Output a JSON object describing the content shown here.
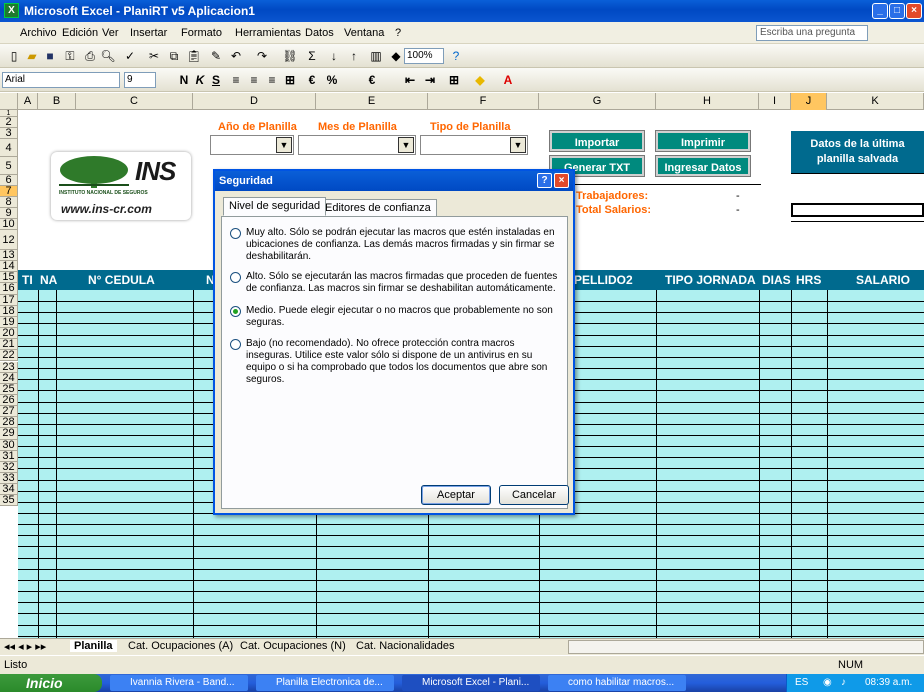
{
  "window": {
    "title": "Microsoft Excel - PlaniRT v5 Aplicacion1",
    "app_icon": "excel-icon"
  },
  "menu": {
    "items": [
      "Archivo",
      "Edición",
      "Ver",
      "Insertar",
      "Formato",
      "Herramientas",
      "Datos",
      "Ventana",
      "?"
    ],
    "ask_placeholder": "Escriba una pregunta"
  },
  "toolbar": {
    "zoom": "100%"
  },
  "format_bar": {
    "font": "Arial",
    "size": "9"
  },
  "columns": [
    "A",
    "B",
    "C",
    "D",
    "E",
    "F",
    "G",
    "H",
    "I",
    "J",
    "K"
  ],
  "selected_column": "J",
  "rows": [
    "1",
    "2",
    "3",
    "4",
    "5",
    "6",
    "7",
    "8",
    "9",
    "10",
    "12",
    "13",
    "14",
    "15",
    "16",
    "17",
    "18",
    "19",
    "20",
    "21",
    "22",
    "23",
    "24",
    "25",
    "26",
    "27",
    "28",
    "29",
    "30",
    "31",
    "32",
    "33",
    "34",
    "35"
  ],
  "selected_row": "7",
  "sheet": {
    "logo_text": "INS",
    "logo_sub": "INSTITUTO NACIONAL DE SEGUROS",
    "website": "www.ins-cr.com",
    "label_year": "Año de Planilla",
    "label_month": "Mes de Planilla",
    "label_type": "Tipo de Planilla",
    "btn_import": "Importar",
    "btn_print": "Imprimir",
    "btn_txt": "Generar TXT",
    "btn_enter": "Ingresar Datos",
    "trabajadores_label": "Trabajadores:",
    "trabajadores_value": "-",
    "salarios_label": "Total Salarios:",
    "salarios_value": "-",
    "datos_title": "Datos de la última planilla salvada",
    "headers": [
      "TI",
      "NA",
      "N° CEDULA",
      "N",
      "PELLIDO2",
      "TIPO JORNADA",
      "DIAS",
      "HRS",
      "SALARIO"
    ]
  },
  "dialog": {
    "title": "Seguridad",
    "tabs": [
      "Nivel de seguridad",
      "Editores de confianza"
    ],
    "options": [
      {
        "text": "Muy alto. Sólo se podrán ejecutar las macros que estén instaladas en ubicaciones de confianza. Las demás macros firmadas y sin firmar se deshabilitarán.",
        "selected": false
      },
      {
        "text": "Alto. Sólo se ejecutarán las macros firmadas que proceden de fuentes de confianza. Las macros sin firmar se deshabilitan automáticamente.",
        "selected": false
      },
      {
        "text": "Medio. Puede elegir ejecutar o no macros que probablemente no son seguras.",
        "selected": true
      },
      {
        "text": "Bajo (no recomendado). No ofrece protección contra macros inseguras. Utilice este valor sólo si dispone de un antivirus en su equipo o si ha comprobado que todos los documentos que abre son seguros.",
        "selected": false
      }
    ],
    "ok": "Aceptar",
    "cancel": "Cancelar"
  },
  "sheet_tabs": [
    "Planilla",
    "Cat. Ocupaciones (A)",
    "Cat. Ocupaciones (N)",
    "Cat. Nacionalidades"
  ],
  "status": {
    "left": "Listo",
    "num": "NUM"
  },
  "taskbar": {
    "start": "Inicio",
    "tasks": [
      "Ivannia Rivera - Band...",
      "Planilla Electronica de...",
      "Microsoft Excel - Plani...",
      "como habilitar macros..."
    ],
    "lang": "ES",
    "time": "08:39 a.m."
  }
}
